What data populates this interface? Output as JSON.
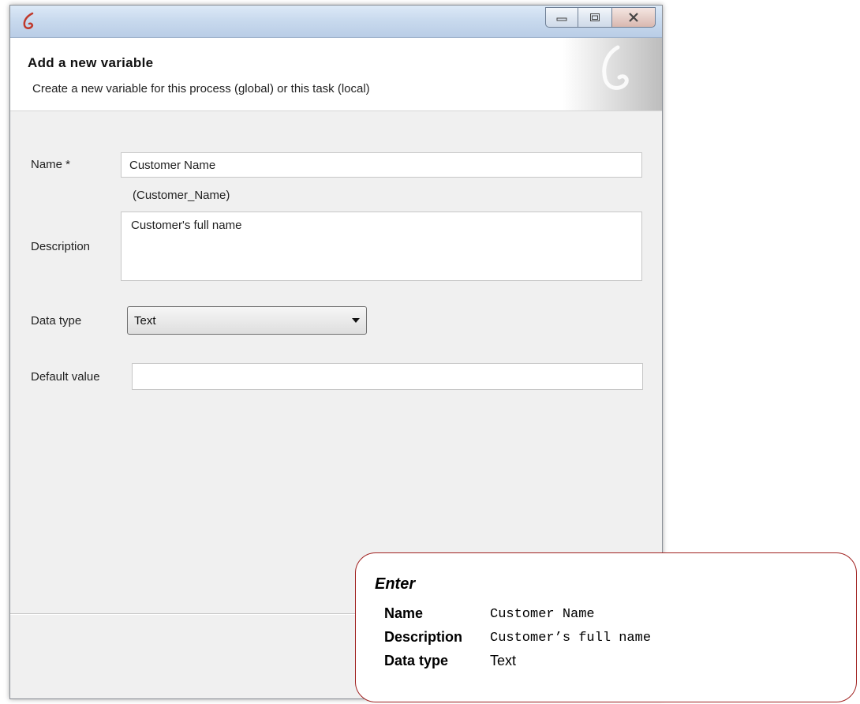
{
  "window": {
    "controls": {
      "minimize_icon": "minimize-icon",
      "maximize_icon": "maximize-icon",
      "close_icon": "close-icon"
    }
  },
  "header": {
    "title": "Add a new variable",
    "subtitle": "Create a new variable for this process (global) or this task (local)"
  },
  "form": {
    "name_label": "Name *",
    "name_value": "Customer Name",
    "name_id_hint": "(Customer_Name)",
    "description_label": "Description",
    "description_value": "Customer's full name",
    "data_type_label": "Data type",
    "data_type_value": "Text",
    "default_value_label": "Default value",
    "default_value_value": ""
  },
  "callout": {
    "title": "Enter",
    "rows": [
      {
        "key": "Name",
        "value": "Customer Name"
      },
      {
        "key": "Description",
        "value": "Customer’s full name"
      },
      {
        "key": "Data type",
        "value": "Text"
      }
    ]
  }
}
